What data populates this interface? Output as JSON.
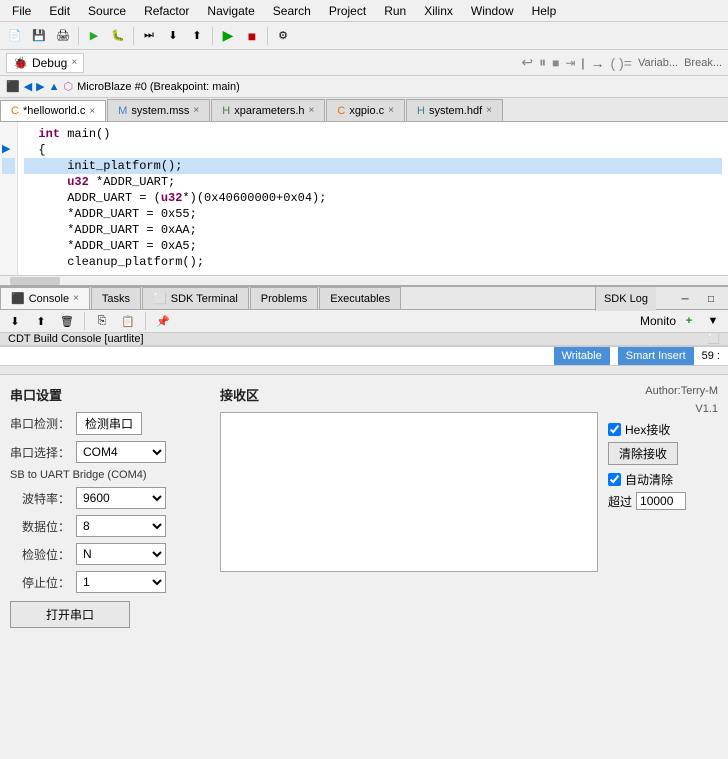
{
  "menu": {
    "items": [
      "File",
      "Edit",
      "Source",
      "Refactor",
      "Navigate",
      "Search",
      "Project",
      "Run",
      "Xilinx",
      "Window",
      "Help"
    ]
  },
  "debug": {
    "tab_label": "Debug",
    "close_icon": "×",
    "breadcrumb": "MicroBlaze #0 (Breakpoint: main)"
  },
  "panels_right": {
    "variables_tab": "Variab...",
    "breakpoints_tab": "Break..."
  },
  "file_tabs": [
    {
      "label": "*helloworld.c",
      "icon": "c",
      "active": true
    },
    {
      "label": "system.mss",
      "icon": "m"
    },
    {
      "label": "xparameters.h",
      "icon": "h"
    },
    {
      "label": "xgpio.c",
      "icon": "c"
    },
    {
      "label": "system.hdf",
      "icon": "h"
    }
  ],
  "code": {
    "lines": [
      {
        "num": "",
        "gutter": "",
        "text": "  int main()",
        "class": ""
      },
      {
        "num": "",
        "gutter": "▶",
        "text": "  {",
        "class": ""
      },
      {
        "num": "",
        "gutter": "",
        "text": "      init_platform();",
        "class": "highlight"
      },
      {
        "num": "",
        "gutter": "",
        "text": "",
        "class": ""
      },
      {
        "num": "",
        "gutter": "",
        "text": "      u32 *ADDR_UART;",
        "class": ""
      },
      {
        "num": "",
        "gutter": "",
        "text": "      ADDR_UART = (u32*)(0x40600000+0x04);",
        "class": ""
      },
      {
        "num": "",
        "gutter": "",
        "text": "      *ADDR_UART = 0x55;",
        "class": ""
      },
      {
        "num": "",
        "gutter": "",
        "text": "      *ADDR_UART = 0xAA;",
        "class": ""
      },
      {
        "num": "",
        "gutter": "",
        "text": "      *ADDR_UART = 0xA5;",
        "class": ""
      },
      {
        "num": "",
        "gutter": "",
        "text": "",
        "class": ""
      },
      {
        "num": "",
        "gutter": "",
        "text": "      cleanup_platform();",
        "class": ""
      }
    ]
  },
  "bottom_panel": {
    "tabs": [
      "Console",
      "Tasks",
      "SDK Terminal",
      "Problems",
      "Executables"
    ],
    "active_tab": "Console",
    "sdk_log_label": "SDK Log",
    "title": "CDT Build Console [uartlite]",
    "monitor_label": "Monito",
    "add_icon": "+"
  },
  "status_bar": {
    "writable_label": "Writable",
    "smart_insert_label": "Smart Insert",
    "position": "59 :"
  },
  "serial_tool": {
    "title": "串口设置",
    "detect_btn_label": "检测串口",
    "port_label": "串口选择：",
    "port_value": "COM4",
    "bridge_info": "SB to UART Bridge (COM4)",
    "baud_label": "波特率：",
    "baud_value": "9600",
    "data_bits_label": "数据位：",
    "data_bits_value": "8",
    "check_label": "检验位：",
    "check_value": "N",
    "stop_label": "停止位：",
    "stop_value": "1",
    "open_btn_label": "打开串口",
    "recv_title": "接收区",
    "author": "Author:Terry-M",
    "version": "V1.1",
    "hex_recv_label": "Hex接收",
    "clear_btn_label": "清除接收",
    "auto_clear_label": "自动清除",
    "limit_label": "超过",
    "limit_value": "10000",
    "port_field_label": "串口检测："
  }
}
